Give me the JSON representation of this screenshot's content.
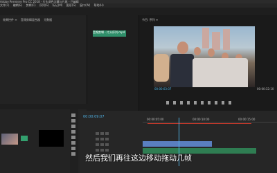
{
  "titlebar": {
    "text": "Adobe Premiere Pro CC 2018 - 片头调色字幕与片尾 - 已编辑"
  },
  "menu": [
    "文件(F)",
    "编辑(E)",
    "剪辑(C)",
    "序列(S)",
    "标记(M)",
    "图形(G)",
    "窗口(W)",
    "帮助(H)"
  ],
  "effects_tabs": [
    "效果控件 ≡",
    "音频剪辑混合器",
    "元数据"
  ],
  "source_clip": "音频剪辑 - 片头序列.mp4",
  "program": {
    "tab": "节目: 序列 ≡",
    "timecode_left": "00:00:03:07",
    "timecode_right": "00:00:32:10"
  },
  "timeline": {
    "timecode": "00:00:09:07",
    "ruler_labels": [
      "00:00:05:00",
      "00:00:10:00",
      "00:00:15:00"
    ]
  },
  "subtitle": "然后我们再往这边移动拖动几帧",
  "colors": {
    "accent": "#4fb3e6",
    "clip_green": "#2f8f6a",
    "track_video": "#5a7fc0",
    "track_audio": "#2f7d52"
  }
}
